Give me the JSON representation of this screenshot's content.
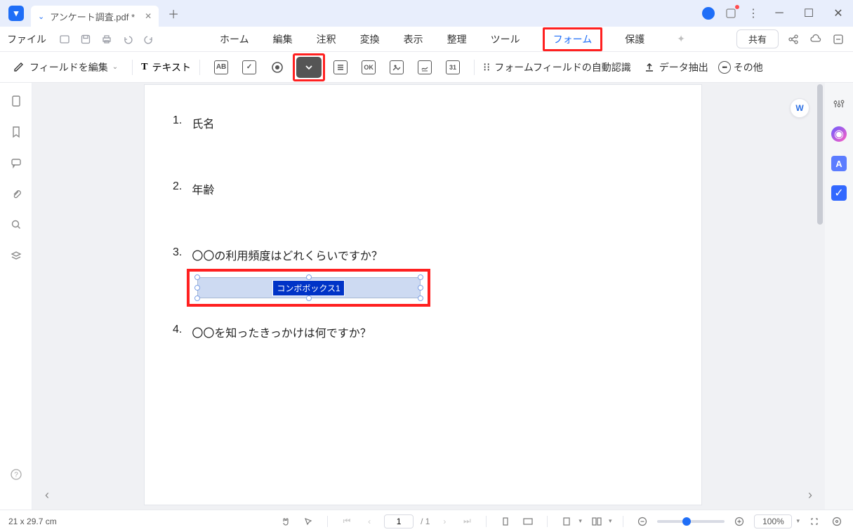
{
  "title_tab": "アンケート調査.pdf *",
  "menubar": {
    "file": "ファイル",
    "items": [
      "ホーム",
      "編集",
      "注釈",
      "変換",
      "表示",
      "整理",
      "ツール",
      "フォーム",
      "保護"
    ],
    "active_index": 7,
    "share": "共有"
  },
  "toolbar": {
    "edit_fields": "フィールドを編集",
    "text_tool": "テキスト",
    "auto_detect": "フォームフィールドの自動認識",
    "data_extract": "データ抽出",
    "more": "その他"
  },
  "document": {
    "q1_num": "1.",
    "q1_text": "氏名",
    "q2_num": "2.",
    "q2_text": "年齢",
    "q3_num": "3.",
    "q3_text": "〇〇の利用頻度はどれくらいですか？",
    "combo_label": "コンボボックス1",
    "q4_num": "4.",
    "q4_text": "〇〇を知ったきっかけは何ですか？"
  },
  "status": {
    "dimensions": "21 x 29.7 cm",
    "page_current": "1",
    "page_total": "/ 1",
    "zoom": "100%"
  }
}
